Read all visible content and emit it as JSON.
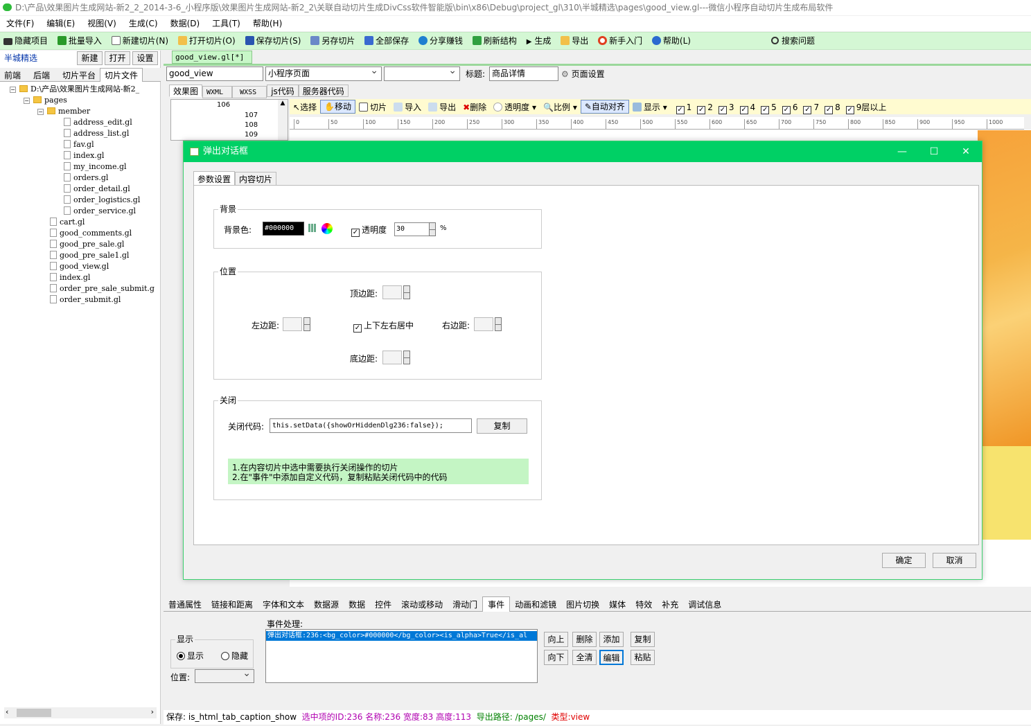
{
  "window": {
    "title": "D:\\产品\\效果图片生成网站-新2_2_2014-3-6_小程序版\\效果图片生成网站-新2_2\\关联自动切片生成DivCss软件智能版\\bin\\x86\\Debug\\project_gl\\310\\半城精选\\pages\\good_view.gl---微信小程序自动切片生成布局软件"
  },
  "menu": [
    "文件(F)",
    "编辑(E)",
    "视图(V)",
    "生成(C)",
    "数据(D)",
    "工具(T)",
    "帮助(H)"
  ],
  "toolbar": {
    "hide": "隐藏项目",
    "batch_import": "批量导入",
    "new_slice": "新建切片(N)",
    "open_slice": "打开切片(O)",
    "save_slice": "保存切片(S)",
    "save_as": "另存切片",
    "save_all": "全部保存",
    "share": "分享赚钱",
    "refresh": "刷新结构",
    "generate": "生成",
    "export": "导出",
    "beginner": "新手入门",
    "help": "帮助(L)",
    "search": "搜索问题"
  },
  "left": {
    "project": "半城精选",
    "new_btn": "新建",
    "open_btn": "打开",
    "settings_btn": "设置",
    "tabs": [
      "前端",
      "后端",
      "切片平台",
      "切片文件"
    ],
    "tree": {
      "root": "D:\\产品\\效果图片生成网站-新2_",
      "pages": "pages",
      "member": "member",
      "member_files": [
        "address_edit.gl",
        "address_list.gl",
        "fav.gl",
        "index.gl",
        "my_income.gl",
        "orders.gl",
        "order_detail.gl",
        "order_logistics.gl",
        "order_service.gl"
      ],
      "page_files": [
        "cart.gl",
        "good_comments.gl",
        "good_pre_sale.gl",
        "good_pre_sale1.gl",
        "good_view.gl",
        "index.gl",
        "order_pre_sale_submit.g",
        "order_submit.gl"
      ]
    }
  },
  "editor": {
    "doc_tab": "good_view.gl[*]",
    "name_value": "good_view",
    "page_type": "小程序页面",
    "title_label": "标题:",
    "title_value": "商品详情",
    "page_settings": "页面设置",
    "subtabs": [
      "效果图",
      "WXML",
      "WXSS",
      "js代码",
      "服务器代码"
    ],
    "line_numbers": [
      "106",
      "107",
      "108",
      "109"
    ],
    "tools": {
      "select": "选择",
      "move": "移动",
      "slice": "切片",
      "import": "导入",
      "export": "导出",
      "delete": "删除",
      "opacity": "透明度",
      "scale": "比例",
      "auto_align": "自动对齐",
      "show": "显示",
      "layers": [
        "1",
        "2",
        "3",
        "4",
        "5",
        "6",
        "7",
        "8"
      ],
      "layers_more": "9层以上"
    },
    "ruler": [
      "0",
      "50",
      "100",
      "150",
      "200",
      "250",
      "300",
      "350",
      "400",
      "450",
      "500",
      "550",
      "600",
      "650",
      "700",
      "750",
      "800",
      "850",
      "900",
      "950",
      "1000"
    ]
  },
  "dialog": {
    "title": "弹出对话框",
    "tabs": [
      "参数设置",
      "内容切片"
    ],
    "background": {
      "group": "背景",
      "color_label": "背景色:",
      "color_value": "#000000",
      "opacity_label": "透明度",
      "opacity_value": "30",
      "percent": "%"
    },
    "position": {
      "group": "位置",
      "top": "顶边距:",
      "left": "左边距:",
      "center": "上下左右居中",
      "right": "右边距:",
      "bottom": "底边距:"
    },
    "close": {
      "group": "关闭",
      "code_label": "关闭代码:",
      "code_value": "this.setData({showOrHiddenDlg236:false});",
      "copy": "复制",
      "hint1": "1.在内容切片中选中需要执行关闭操作的切片",
      "hint2": "2.在\"事件\"中添加自定义代码，复制粘贴关闭代码中的代码"
    },
    "ok": "确定",
    "cancel": "取消"
  },
  "bottom": {
    "tabs": [
      "普通属性",
      "链接和距离",
      "字体和文本",
      "数据源",
      "数据",
      "控件",
      "滚动或移动",
      "滑动门",
      "事件",
      "动画和滤镜",
      "图片切换",
      "媒体",
      "特效",
      "补充",
      "调试信息"
    ],
    "display_group": "显示",
    "show": "显示",
    "hide": "隐藏",
    "position_label": "位置:",
    "event_label": "事件处理:",
    "event_item": "弹出对话框:236:<bg_color>#000000</bg_color><is_alpha>True</is_al",
    "buttons": {
      "up": "向上",
      "delete": "删除",
      "add": "添加",
      "copy": "复制",
      "down": "向下",
      "clear": "全清",
      "edit": "编辑",
      "paste": "粘贴"
    }
  },
  "status": {
    "save": "保存:  is_html_tab_caption_show",
    "selected": "选中项的ID:236 名称:236 宽度:83 高度:113",
    "export_label": "导出路径:",
    "export_path": "/pages/",
    "type": "类型:view"
  },
  "colors": {
    "accent": "#00d065",
    "toolbar_bg": "#d4f7d4",
    "hint_bg": "#c4f5c4",
    "status_purple": "#b000b0",
    "status_red": "#e00000",
    "status_green": "#008000"
  }
}
